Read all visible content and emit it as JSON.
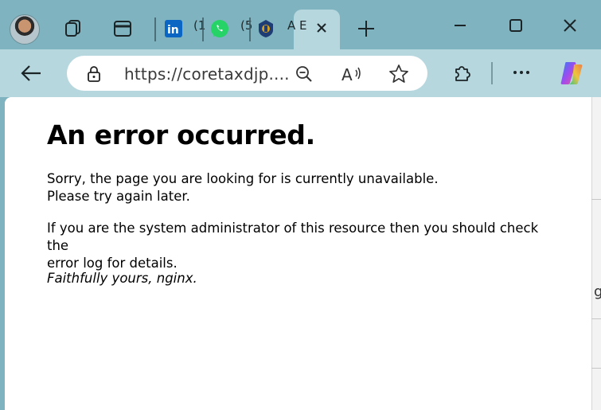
{
  "browser": {
    "tabs": [
      {
        "name": "linkedin",
        "fragment": "(1"
      },
      {
        "name": "whatsapp",
        "fragment": "(5"
      },
      {
        "name": "coretax",
        "fragment": "A E",
        "active": true
      }
    ],
    "address_bar": {
      "url": "https://coretaxdjp...."
    },
    "colors": {
      "frame": "#7fb3bf",
      "toolbar": "#b7d7de",
      "active_tab": "#b7d7de"
    }
  },
  "page": {
    "heading": "An error occurred.",
    "para1_line1": "Sorry, the page you are looking for is currently unavailable.",
    "para1_line2": "Please try again later.",
    "para2_line1": "If you are the system administrator of this resource then you should check the",
    "para2_line2": "error log for details.",
    "signature": "Faithfully yours, nginx."
  },
  "side_panel": {
    "fragment": "g"
  }
}
